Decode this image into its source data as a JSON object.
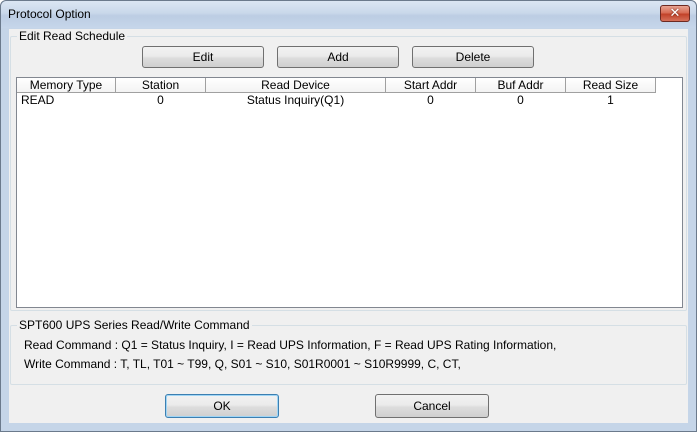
{
  "window": {
    "title": "Protocol Option",
    "close_symbol": "✕"
  },
  "edit_group": {
    "label": "Edit Read Schedule",
    "buttons": {
      "edit": "Edit",
      "add": "Add",
      "delete": "Delete"
    }
  },
  "list": {
    "columns": [
      "Memory Type",
      "Station",
      "Read Device",
      "Start Addr",
      "Buf Addr",
      "Read Size"
    ],
    "rows": [
      [
        "READ",
        "0",
        "Status Inquiry(Q1)",
        "0",
        "0",
        "1"
      ]
    ]
  },
  "info_group": {
    "label": "SPT600 UPS Series Read/Write Command",
    "read_command": "Read Command : Q1 = Status Inquiry,  I = Read UPS Information,  F = Read UPS Rating Information,",
    "write_command": "Write Command : T, TL, T01 ~ T99, Q, S01 ~ S10, S01R0001 ~ S10R9999, C, CT,"
  },
  "footer": {
    "ok": "OK",
    "cancel": "Cancel"
  },
  "colors": {
    "frame": "#c5d5e8",
    "client": "#f0f0f0",
    "close": "#c2432a"
  },
  "icons": {
    "close": "close-icon"
  }
}
